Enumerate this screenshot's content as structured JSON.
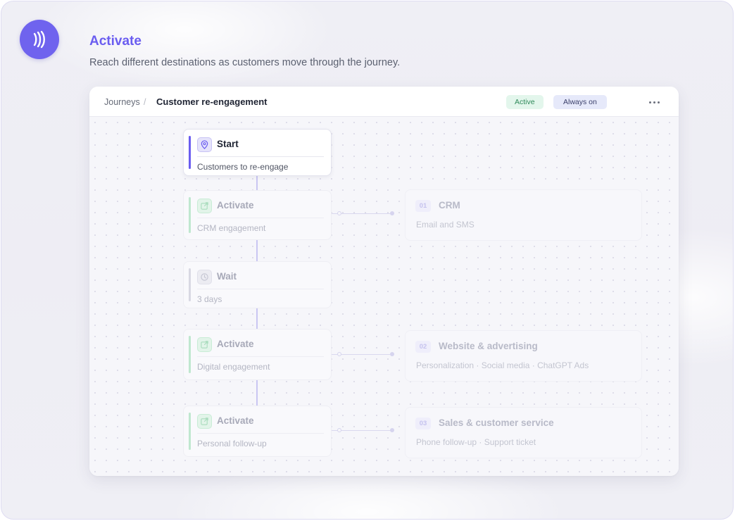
{
  "hero": {
    "title": "Activate",
    "subtitle": "Reach different destinations as customers move through the journey."
  },
  "colors": {
    "accent": "#6a5df0",
    "activate_green": "#bfe7cf",
    "active_badge_bg": "#e3f6ec",
    "always_on_badge_bg": "#e6e9fa"
  },
  "panel": {
    "breadcrumb_root": "Journeys",
    "breadcrumb_separator": "/",
    "breadcrumb_current": "Customer re-engagement",
    "status_badge": "Active",
    "mode_badge": "Always on",
    "more_icon": "ellipsis-icon"
  },
  "nodes": {
    "start": {
      "title": "Start",
      "subtitle": "Customers to re-engage",
      "icon": "location-pin-icon"
    },
    "crm_activate": {
      "title": "Activate",
      "subtitle": "CRM engagement",
      "icon": "external-link-icon"
    },
    "wait": {
      "title": "Wait",
      "subtitle": "3 days",
      "icon": "clock-icon"
    },
    "digital_activate": {
      "title": "Activate",
      "subtitle": "Digital engagement",
      "icon": "external-link-icon"
    },
    "personal_activate": {
      "title": "Activate",
      "subtitle": "Personal follow-up",
      "icon": "external-link-icon"
    }
  },
  "destinations": [
    {
      "number": "01",
      "title": "CRM",
      "subtitle": "Email and SMS"
    },
    {
      "number": "02",
      "title": "Website & advertising",
      "subtitle": "Personalization · Social media · ChatGPT Ads"
    },
    {
      "number": "03",
      "title": "Sales & customer service",
      "subtitle": "Phone follow-up · Support ticket"
    }
  ]
}
